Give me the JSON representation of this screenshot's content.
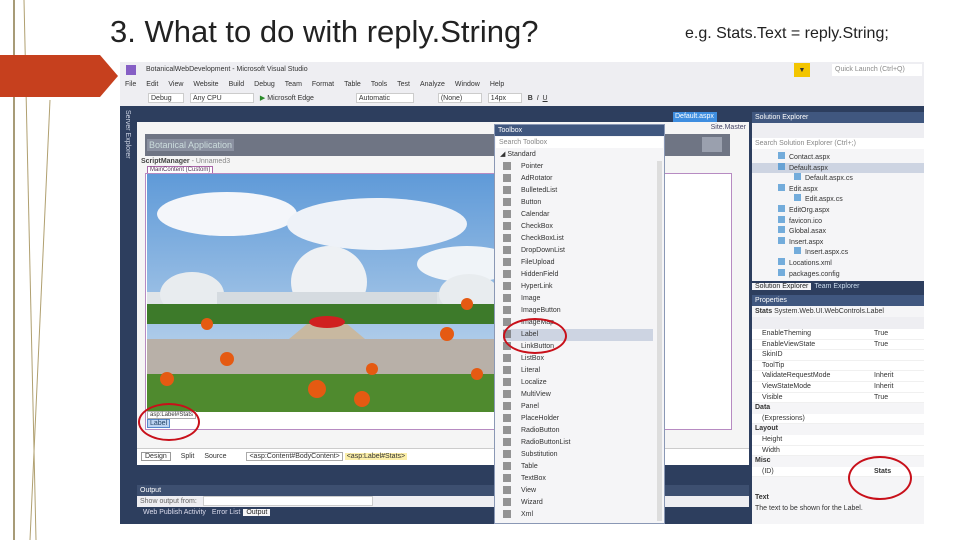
{
  "slide": {
    "title": "3. What to do with reply.String?",
    "note": "e.g. Stats.Text = reply.String;"
  },
  "vs": {
    "window_title": "BotanicalWebDevelopment - Microsoft Visual Studio",
    "quick_launch": "Quick Launch (Ctrl+Q)",
    "menu": [
      "File",
      "Edit",
      "View",
      "Website",
      "Build",
      "Debug",
      "Team",
      "Format",
      "Table",
      "Tools",
      "Test",
      "Analyze",
      "Window",
      "Help"
    ],
    "toolbar": {
      "config": "Debug",
      "platform": "Any CPU",
      "run": "Microsoft Edge",
      "style": "Automatic",
      "class": "(None)",
      "size": "14px",
      "bold": "B",
      "italic": "I",
      "underline": "U"
    },
    "server_explorer": "Server Explorer",
    "doc_tab": "Default.aspx",
    "master_link": "Site.Master",
    "designer": {
      "app_title": "Botanical Application",
      "script_manager": "ScriptManager",
      "script_manager_id": "- Unnamed3",
      "content_tag": "MainContent (Custom)",
      "label_tag": "asp:Label#Stats",
      "label_text": "Label"
    },
    "view_tabs": {
      "design": "Design",
      "split": "Split",
      "source": "Source",
      "crumb1": "<asp:Content#BodyContent>",
      "crumb2": "<asp:Label#Stats>"
    },
    "output": {
      "title": "Output",
      "show_from": "Show output from:",
      "tabs": [
        "Web Publish Activity",
        "Error List",
        "Output"
      ]
    },
    "toolbox": {
      "title": "Toolbox",
      "search": "Search Toolbox",
      "group": "Standard",
      "selected": "Label",
      "items": [
        "Pointer",
        "AdRotator",
        "BulletedList",
        "Button",
        "Calendar",
        "CheckBox",
        "CheckBoxList",
        "DropDownList",
        "FileUpload",
        "HiddenField",
        "HyperLink",
        "Image",
        "ImageButton",
        "ImageMap",
        "Label",
        "LinkButton",
        "ListBox",
        "Literal",
        "Localize",
        "MultiView",
        "Panel",
        "PlaceHolder",
        "RadioButton",
        "RadioButtonList",
        "Substitution",
        "Table",
        "TextBox",
        "View",
        "Wizard",
        "Xml"
      ]
    },
    "solution_explorer": {
      "title": "Solution Explorer",
      "search": "Search Solution Explorer (Ctrl+;)",
      "items": [
        {
          "name": "Contact.aspx",
          "level": 1
        },
        {
          "name": "Default.aspx",
          "level": 1,
          "selected": true
        },
        {
          "name": "Default.aspx.cs",
          "level": 2
        },
        {
          "name": "Edit.aspx",
          "level": 1
        },
        {
          "name": "Edit.aspx.cs",
          "level": 2
        },
        {
          "name": "EditOrg.aspx",
          "level": 1
        },
        {
          "name": "favicon.ico",
          "level": 1
        },
        {
          "name": "Global.asax",
          "level": 1
        },
        {
          "name": "Insert.aspx",
          "level": 1
        },
        {
          "name": "Insert.aspx.cs",
          "level": 2
        },
        {
          "name": "Locations.xml",
          "level": 1
        },
        {
          "name": "packages.config",
          "level": 1
        }
      ],
      "tabs": [
        "Solution Explorer",
        "Team Explorer"
      ]
    },
    "properties": {
      "title": "Properties",
      "object": "Stats",
      "type": "System.Web.UI.WebControls.Label",
      "rows": [
        {
          "k": "EnableTheming",
          "v": "True"
        },
        {
          "k": "EnableViewState",
          "v": "True"
        },
        {
          "k": "SkinID",
          "v": ""
        },
        {
          "k": "ToolTip",
          "v": ""
        },
        {
          "k": "ValidateRequestMode",
          "v": "Inherit"
        },
        {
          "k": "ViewStateMode",
          "v": "Inherit"
        },
        {
          "k": "Visible",
          "v": "True"
        },
        {
          "cat": "Data"
        },
        {
          "k": "(Expressions)",
          "v": ""
        },
        {
          "cat": "Layout"
        },
        {
          "k": "Height",
          "v": ""
        },
        {
          "k": "Width",
          "v": ""
        },
        {
          "cat": "Misc"
        },
        {
          "k": "(ID)",
          "v": "Stats",
          "bold": true
        }
      ],
      "desc_title": "Text",
      "desc": "The text to be shown for the Label."
    }
  },
  "colors": {
    "accent": "#c8101a",
    "vs_dark": "#2d3e5e"
  }
}
